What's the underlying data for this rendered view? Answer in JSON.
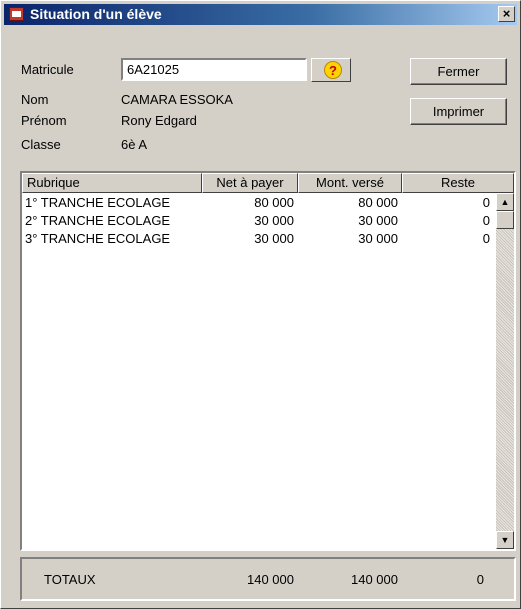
{
  "window": {
    "title": "Situation d'un élève",
    "close_glyph": "×"
  },
  "form": {
    "matricule_label": "Matricule",
    "matricule_value": "6A21025",
    "help_glyph": "?",
    "nom_label": "Nom",
    "nom_value": "CAMARA ESSOKA",
    "prenom_label": "Prénom",
    "prenom_value": "Rony Edgard",
    "classe_label": "Classe",
    "classe_value": "6è A"
  },
  "buttons": {
    "fermer": "Fermer",
    "imprimer": "Imprimer"
  },
  "table": {
    "columns": [
      "Rubrique",
      "Net à payer",
      "Mont. versé",
      "Reste"
    ],
    "rows": [
      {
        "rubrique": "1° TRANCHE ECOLAGE",
        "net": "80 000",
        "verse": "80 000",
        "reste": "0"
      },
      {
        "rubrique": "2° TRANCHE ECOLAGE",
        "net": "30 000",
        "verse": "30 000",
        "reste": "0"
      },
      {
        "rubrique": "3° TRANCHE ECOLAGE",
        "net": "30 000",
        "verse": "30 000",
        "reste": "0"
      }
    ],
    "scroll_up_glyph": "▲",
    "scroll_down_glyph": "▼"
  },
  "totals": {
    "label": "TOTAUX",
    "net": "140 000",
    "verse": "140 000",
    "reste": "0"
  },
  "colors": {
    "title_start": "#0a246a",
    "title_end": "#a6caf0",
    "face": "#d4d0c8"
  }
}
